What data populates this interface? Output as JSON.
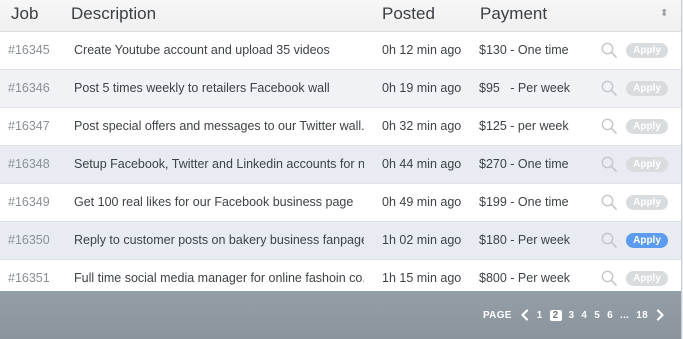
{
  "header": {
    "job": "Job",
    "description": "Description",
    "posted": "Posted",
    "payment": "Payment",
    "sort_glyph": "⬍"
  },
  "rows": [
    {
      "id": "#16345",
      "description": "Create Youtube account and upload 35 videos",
      "posted": "0h 12 min ago",
      "payment": "$130 - One time",
      "apply": "Apply"
    },
    {
      "id": "#16346",
      "description": "Post 5 times weekly to retailers Facebook wall",
      "posted": "0h 19 min ago",
      "payment": "$95   - Per week",
      "apply": "Apply"
    },
    {
      "id": "#16347",
      "description": "Post special offers and messages to our Twitter wall....",
      "posted": "0h 32 min ago",
      "payment": "$125 - per week",
      "apply": "Apply"
    },
    {
      "id": "#16348",
      "description": "Setup Facebook, Twitter and Linkedin accounts for n...",
      "posted": "0h 44 min ago",
      "payment": "$270 - One time",
      "apply": "Apply"
    },
    {
      "id": "#16349",
      "description": "Get 100 real likes for our Facebook business page",
      "posted": "0h 49 min ago",
      "payment": "$199 - One time",
      "apply": "Apply"
    },
    {
      "id": "#16350",
      "description": "Reply to customer posts on bakery business fanpage...",
      "posted": "1h 02 min ago",
      "payment": "$180 - Per week",
      "apply": "Apply",
      "highlighted": true
    },
    {
      "id": "#16351",
      "description": "Full time social media manager for online fashoin co.....",
      "posted": "1h 15 min ago",
      "payment": "$800 - Per week",
      "apply": "Apply"
    }
  ],
  "pagination": {
    "label": "PAGE",
    "pages": [
      "1",
      "2",
      "3",
      "4",
      "5",
      "6",
      "...",
      "18"
    ],
    "current": "2"
  },
  "colors": {
    "apply_active": "#5b9cf0",
    "apply_inactive": "#d9dcdf",
    "footer": "#8f99a2"
  },
  "icons": {
    "row_action": "search-icon",
    "prev": "chevron-left-icon",
    "next": "chevron-right-icon"
  }
}
